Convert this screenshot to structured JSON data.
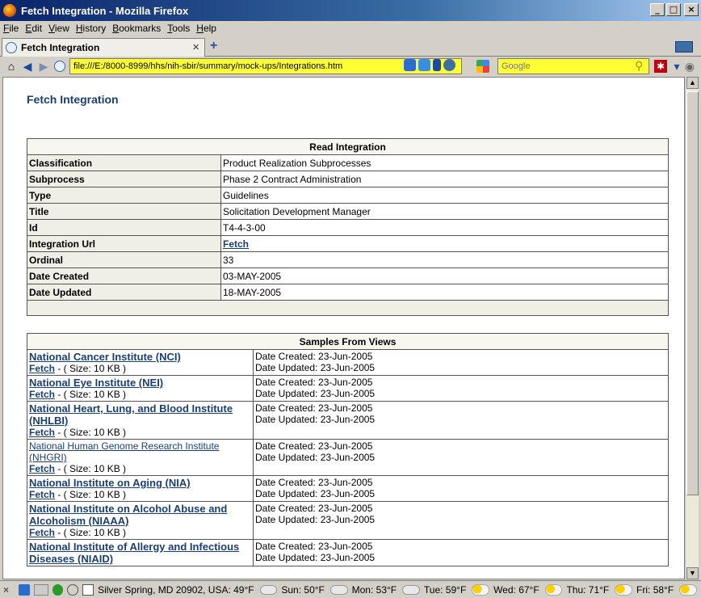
{
  "window": {
    "title": "Fetch Integration - Mozilla Firefox",
    "controls": {
      "minimize": "_",
      "maximize": "□",
      "close": "×"
    }
  },
  "menu": [
    "File",
    "Edit",
    "View",
    "History",
    "Bookmarks",
    "Tools",
    "Help"
  ],
  "tab": {
    "title": "Fetch Integration",
    "close": "×",
    "add": "+"
  },
  "nav": {
    "url": "file:///E:/8000-8999/hhs/nih-sbir/summary/mock-ups/Integrations.htm",
    "search_placeholder": "Google"
  },
  "page": {
    "title": "Fetch Integration",
    "detail": {
      "header": "Read Integration",
      "rows": [
        {
          "label": "Classification",
          "value": "Product Realization Subprocesses"
        },
        {
          "label": "Subprocess",
          "value": "Phase 2 Contract Administration"
        },
        {
          "label": "Type",
          "value": "Guidelines"
        },
        {
          "label": "Title",
          "value": "Solicitation Development Manager"
        },
        {
          "label": "Id",
          "value": "T4-4-3-00"
        },
        {
          "label": "Integration Url",
          "value": "Fetch",
          "is_link": true
        },
        {
          "label": "Ordinal",
          "value": "33"
        },
        {
          "label": "Date Created",
          "value": "03-MAY-2005"
        },
        {
          "label": "Date Updated",
          "value": "18-MAY-2005"
        }
      ]
    },
    "samples": {
      "header": "Samples From Views",
      "rows": [
        {
          "name": "National Cancer Institute (NCI)",
          "fetch": "Fetch",
          "size": " - ( Size: 10 KB )",
          "created": "Date Created: 23-Jun-2005",
          "updated": "Date Updated: 23-Jun-2005"
        },
        {
          "name": "National Eye Institute (NEI)",
          "fetch": "Fetch",
          "size": " - ( Size: 10 KB )",
          "created": "Date Created: 23-Jun-2005",
          "updated": "Date Updated: 23-Jun-2005"
        },
        {
          "name": "National Heart, Lung, and Blood Institute (NHLBI)",
          "fetch": "Fetch",
          "size": " - ( Size: 10 KB )",
          "created": "Date Created: 23-Jun-2005",
          "updated": "Date Updated: 23-Jun-2005"
        },
        {
          "name": "National Human Genome Research Institute (NHGRI)",
          "fetch": "Fetch",
          "size": " - ( Size: 10 KB )",
          "created": "Date Created: 23-Jun-2005",
          "updated": "Date Updated: 23-Jun-2005",
          "plain": true
        },
        {
          "name": "National Institute on Aging (NIA)",
          "fetch": "Fetch",
          "size": " - ( Size: 10 KB )",
          "created": "Date Created: 23-Jun-2005",
          "updated": "Date Updated: 23-Jun-2005"
        },
        {
          "name": "National Institute on Alcohol Abuse and Alcoholism (NIAAA)",
          "fetch": "Fetch",
          "size": " - ( Size: 10 KB )",
          "created": "Date Created: 23-Jun-2005",
          "updated": "Date Updated: 23-Jun-2005"
        },
        {
          "name": "National Institute of Allergy and Infectious Diseases (NIAID)",
          "fetch": "",
          "size": "",
          "created": "Date Created: 23-Jun-2005",
          "updated": "Date Updated: 23-Jun-2005"
        }
      ]
    }
  },
  "status": {
    "location": "Silver Spring, MD 20902, USA: 49°F",
    "forecast": [
      {
        "day": "Sun: 50°F",
        "icon": "cloud-icon"
      },
      {
        "day": "Mon: 53°F",
        "icon": "rain-cloud-icon"
      },
      {
        "day": "Tue: 59°F",
        "icon": "partly-sunny-icon"
      },
      {
        "day": "Wed: 67°F",
        "icon": "partly-sunny-icon"
      },
      {
        "day": "Thu: 71°F",
        "icon": "partly-sunny-icon"
      },
      {
        "day": "Fri: 58°F",
        "icon": "partly-sunny-icon"
      }
    ]
  }
}
